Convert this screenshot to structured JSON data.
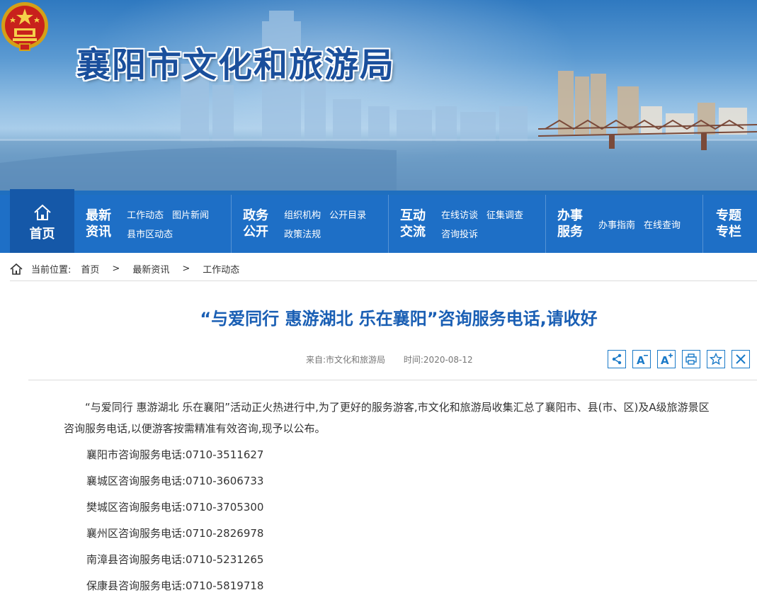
{
  "header": {
    "site_title": "襄阳市文化和旅游局",
    "emblem_icon": "national-emblem-icon"
  },
  "nav": {
    "home": {
      "label": "首页",
      "icon": "home-icon"
    },
    "groups": [
      {
        "title": "最新资讯",
        "title_l1": "最新",
        "title_l2": "资讯",
        "links": [
          "工作动态",
          "图片新闻",
          "县市区动态"
        ]
      },
      {
        "title": "政务公开",
        "title_l1": "政务",
        "title_l2": "公开",
        "links": [
          "组织机构",
          "公开目录",
          "政策法规"
        ]
      },
      {
        "title": "互动交流",
        "title_l1": "互动",
        "title_l2": "交流",
        "links": [
          "在线访谈",
          "征集调查",
          "咨询投诉"
        ]
      },
      {
        "title": "办事服务",
        "title_l1": "办事",
        "title_l2": "服务",
        "links": [
          "办事指南",
          "在线查询"
        ]
      },
      {
        "title": "专题专栏",
        "title_l1": "专题",
        "title_l2": "专栏",
        "links": []
      }
    ]
  },
  "breadcrumb": {
    "label": "当前位置:",
    "items": [
      "首页",
      "最新资讯",
      "工作动态"
    ],
    "separator": ">"
  },
  "article": {
    "title": "“与爱同行 惠游湖北 乐在襄阳”咨询服务电话,请收好",
    "source": "来自:市文化和旅游局",
    "time": "时间:2020-08-12",
    "intro": "“与爱同行 惠游湖北 乐在襄阳”活动正火热进行中,为了更好的服务游客,市文化和旅游局收集汇总了襄阳市、县(市、区)及A级旅游景区咨询服务电话,以便游客按需精准有效咨询,现予以公布。",
    "lines": [
      "襄阳市咨询服务电话:0710-3511627",
      "襄城区咨询服务电话:0710-3606733",
      "樊城区咨询服务电话:0710-3705300",
      "襄州区咨询服务电话:0710-2826978",
      "南漳县咨询服务电话:0710-5231265",
      "保康县咨询服务电话:0710-5819718"
    ]
  },
  "tools": [
    {
      "icon": "share-icon"
    },
    {
      "icon": "font-decrease-icon",
      "glyph": "A"
    },
    {
      "icon": "font-increase-icon",
      "glyph": "A"
    },
    {
      "icon": "print-icon"
    },
    {
      "icon": "favorite-star-icon"
    },
    {
      "icon": "close-icon"
    }
  ],
  "colors": {
    "nav_bg": "#1e6fc6",
    "nav_home_bg": "#1558a8",
    "title_blue": "#1a5fb4",
    "site_title": "#1a4f9c"
  }
}
